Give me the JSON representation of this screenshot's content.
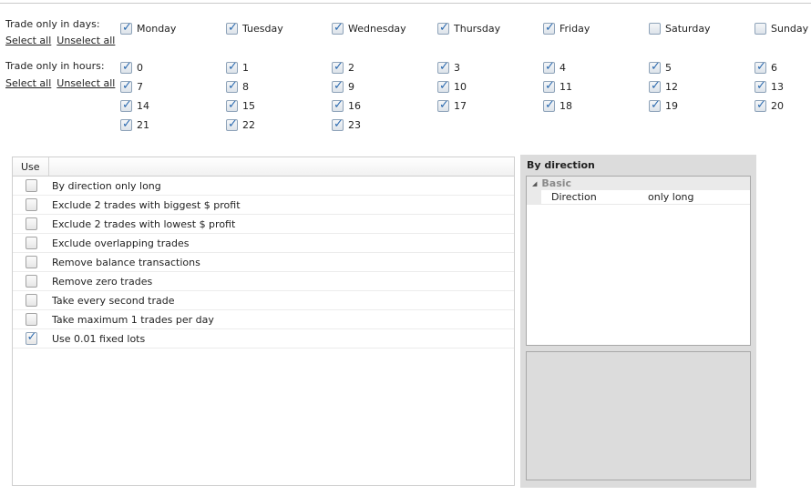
{
  "days": {
    "label": "Trade only in days:",
    "select_all": "Select all",
    "unselect_all": "Unselect all",
    "items": [
      {
        "label": "Monday",
        "checked": true
      },
      {
        "label": "Tuesday",
        "checked": true
      },
      {
        "label": "Wednesday",
        "checked": true
      },
      {
        "label": "Thursday",
        "checked": true
      },
      {
        "label": "Friday",
        "checked": true
      },
      {
        "label": "Saturday",
        "checked": false
      },
      {
        "label": "Sunday",
        "checked": false
      }
    ]
  },
  "hours": {
    "label": "Trade only in hours:",
    "select_all": "Select all",
    "unselect_all": "Unselect all",
    "items": [
      {
        "label": "0",
        "checked": true
      },
      {
        "label": "1",
        "checked": true
      },
      {
        "label": "2",
        "checked": true
      },
      {
        "label": "3",
        "checked": true
      },
      {
        "label": "4",
        "checked": true
      },
      {
        "label": "5",
        "checked": true
      },
      {
        "label": "6",
        "checked": true
      },
      {
        "label": "7",
        "checked": true
      },
      {
        "label": "8",
        "checked": true
      },
      {
        "label": "9",
        "checked": true
      },
      {
        "label": "10",
        "checked": true
      },
      {
        "label": "11",
        "checked": true
      },
      {
        "label": "12",
        "checked": true
      },
      {
        "label": "13",
        "checked": true
      },
      {
        "label": "14",
        "checked": true
      },
      {
        "label": "15",
        "checked": true
      },
      {
        "label": "16",
        "checked": true
      },
      {
        "label": "17",
        "checked": true
      },
      {
        "label": "18",
        "checked": true
      },
      {
        "label": "19",
        "checked": true
      },
      {
        "label": "20",
        "checked": true
      },
      {
        "label": "21",
        "checked": true
      },
      {
        "label": "22",
        "checked": true
      },
      {
        "label": "23",
        "checked": true
      }
    ]
  },
  "filters": {
    "header_use": "Use",
    "rows": [
      {
        "label": "By direction only long",
        "checked": false
      },
      {
        "label": "Exclude 2 trades with biggest $ profit",
        "checked": false
      },
      {
        "label": "Exclude 2 trades with lowest $ profit",
        "checked": false
      },
      {
        "label": "Exclude overlapping trades",
        "checked": false
      },
      {
        "label": "Remove balance transactions",
        "checked": false
      },
      {
        "label": "Remove zero trades",
        "checked": false
      },
      {
        "label": "Take every second trade",
        "checked": false
      },
      {
        "label": "Take maximum 1 trades per day",
        "checked": false
      },
      {
        "label": "Use 0.01 fixed lots",
        "checked": true
      }
    ]
  },
  "panel": {
    "title": "By direction",
    "group": "Basic",
    "property_name": "Direction",
    "property_value": "only long"
  }
}
